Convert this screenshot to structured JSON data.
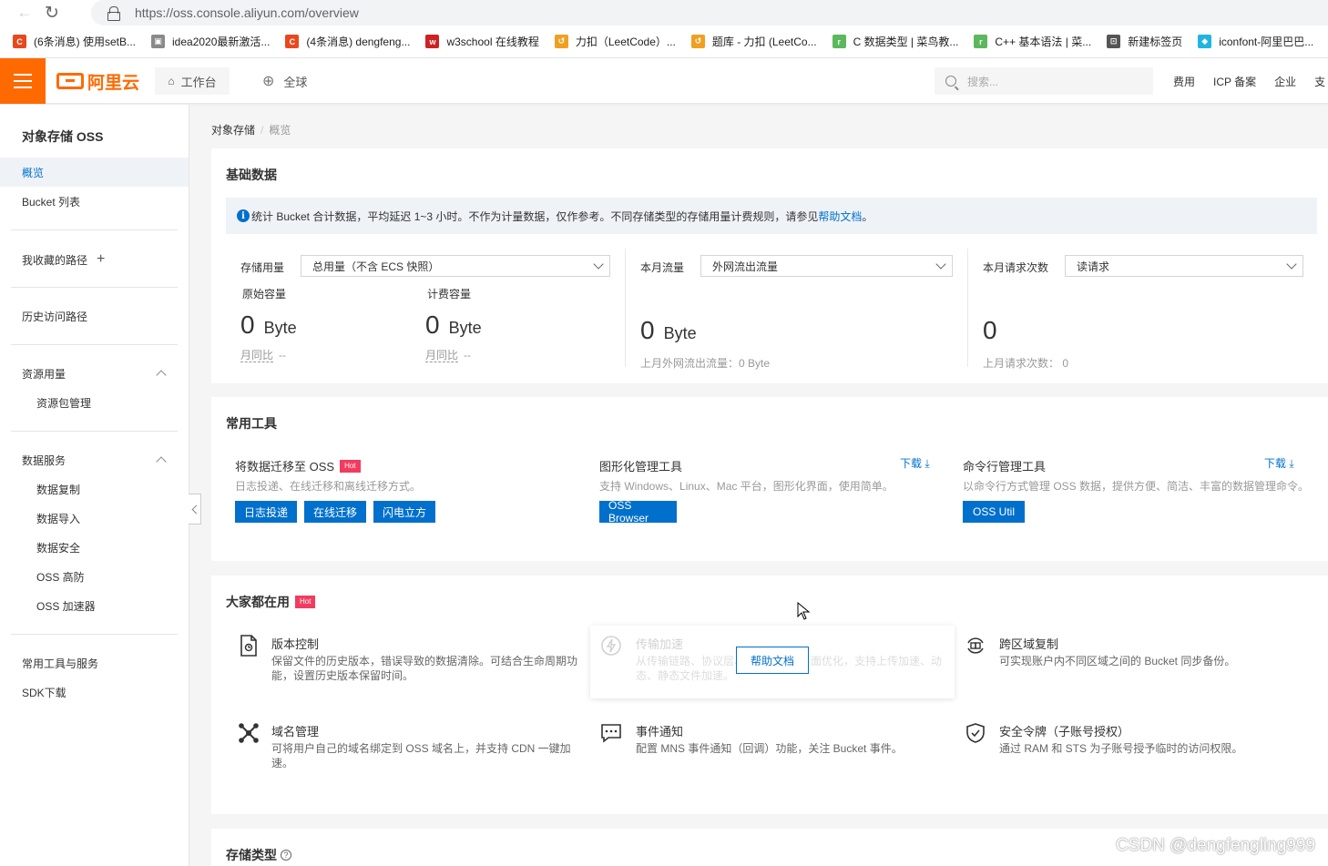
{
  "browser": {
    "url": "https://oss.console.aliyun.com/overview",
    "bookmarks": [
      {
        "label": "(6条消息) 使用setB...",
        "icon": "csdn-icon",
        "color": "#e8481d",
        "glyph": "C"
      },
      {
        "label": "idea2020最新激活...",
        "icon": "image-icon",
        "color": "#8a8a8a",
        "glyph": "▣"
      },
      {
        "label": "(4条消息) dengfeng...",
        "icon": "csdn-icon",
        "color": "#e8481d",
        "glyph": "C"
      },
      {
        "label": "w3school 在线教程",
        "icon": "w3school-icon",
        "color": "#c22",
        "glyph": "w"
      },
      {
        "label": "力扣（LeetCode）...",
        "icon": "leetcode-icon",
        "color": "#f0a020",
        "glyph": "↺"
      },
      {
        "label": "题库 - 力扣 (LeetCo...",
        "icon": "leetcode-icon",
        "color": "#f0a020",
        "glyph": "↺"
      },
      {
        "label": "C 数据类型 | 菜鸟教...",
        "icon": "runoob-icon",
        "color": "#5cb85c",
        "glyph": "r"
      },
      {
        "label": "C++ 基本语法 | 菜...",
        "icon": "runoob-icon",
        "color": "#5cb85c",
        "glyph": "r"
      },
      {
        "label": "新建标签页",
        "icon": "newtab-icon",
        "color": "#555",
        "glyph": "⊡"
      },
      {
        "label": "iconfont-阿里巴巴...",
        "icon": "iconfont-icon",
        "color": "#1fb5e3",
        "glyph": "◆"
      }
    ]
  },
  "topbar": {
    "logo": "阿里云",
    "workbench": "工作台",
    "global": "全球",
    "search_placeholder": "搜索...",
    "links": [
      "费用",
      "ICP 备案",
      "企业",
      "支"
    ]
  },
  "sidebar": {
    "title": "对象存储 OSS",
    "overview": "概览",
    "bucket_list": "Bucket 列表",
    "fav_paths": "我收藏的路径",
    "history_paths": "历史访问路径",
    "resource_usage": "资源用量",
    "resource_pkg": "资源包管理",
    "data_services": "数据服务",
    "data_copy": "数据复制",
    "data_import": "数据导入",
    "data_security": "数据安全",
    "oss_ddos": "OSS 高防",
    "oss_accel": "OSS 加速器",
    "tools_services": "常用工具与服务",
    "sdk_download": "SDK下载"
  },
  "breadcrumb": {
    "root": "对象存储",
    "current": "概览"
  },
  "basic": {
    "title": "基础数据",
    "notice_text": "统计 Bucket 合计数据，平均延迟 1~3 小时。不作为计量数据，仅作参考。不同存储类型的存储用量计费规则，请参见",
    "notice_link": "帮助文档",
    "notice_end": "。",
    "storage_label": "存储用量",
    "storage_select": "总用量（不含 ECS 快照）",
    "raw_label": "原始容量",
    "raw_value": "0",
    "raw_unit": "Byte",
    "raw_mom_label": "月同比",
    "raw_mom_value": "--",
    "billed_label": "计费容量",
    "billed_value": "0",
    "billed_unit": "Byte",
    "billed_mom_label": "月同比",
    "billed_mom_value": "--",
    "traffic_label": "本月流量",
    "traffic_select": "外网流出流量",
    "traffic_value": "0",
    "traffic_unit": "Byte",
    "traffic_last": "上月外网流出流量：0 Byte",
    "requests_label": "本月请求次数",
    "requests_select": "读请求",
    "requests_value": "0",
    "requests_last": "上月请求次数： 0"
  },
  "tools": {
    "title": "常用工具",
    "migrate_title": "将数据迁移至 OSS",
    "migrate_hot": "Hot",
    "migrate_desc": "日志投递、在线迁移和离线迁移方式。",
    "btn_log": "日志投递",
    "btn_online": "在线迁移",
    "btn_flash": "闪电立方",
    "gui_title": "图形化管理工具",
    "gui_download": "下载 ⤓",
    "gui_desc": "支持 Windows、Linux、Mac 平台，图形化界面，使用简单。",
    "gui_btn": "OSS Browser",
    "cli_title": "命令行管理工具",
    "cli_download": "下载 ⤓",
    "cli_desc": "以命令行方式管理 OSS 数据，提供方便、简洁、丰富的数据管理命令。",
    "cli_btn": "OSS Util"
  },
  "popular": {
    "title": "大家都在用",
    "hot": "Hot",
    "version_title": "版本控制",
    "version_desc": "保留文件的历史版本，错误导致的数据清除。可结合生命周期功能，设置历史版本保留时间。",
    "accel_title": "传输加速",
    "accel_desc": "从传输链路、协议层、应用层等多方面优化，支持上传加速、动态、静态文件加速。",
    "help_btn": "帮助文档",
    "cross_title": "跨区域复制",
    "cross_desc": "可实现账户内不同区域之间的 Bucket 同步备份。",
    "domain_title": "域名管理",
    "domain_desc": "可将用户自己的域名绑定到 OSS 域名上，并支持 CDN 一键加速。",
    "event_title": "事件通知",
    "event_desc": "配置 MNS 事件通知（回调）功能，关注 Bucket 事件。",
    "token_title": "安全令牌（子账号授权）",
    "token_desc": "通过 RAM 和 STS 为子账号授予临时的访问权限。"
  },
  "storage_types": {
    "title": "存储类型"
  },
  "watermark": "CSDN @dengfengling999"
}
